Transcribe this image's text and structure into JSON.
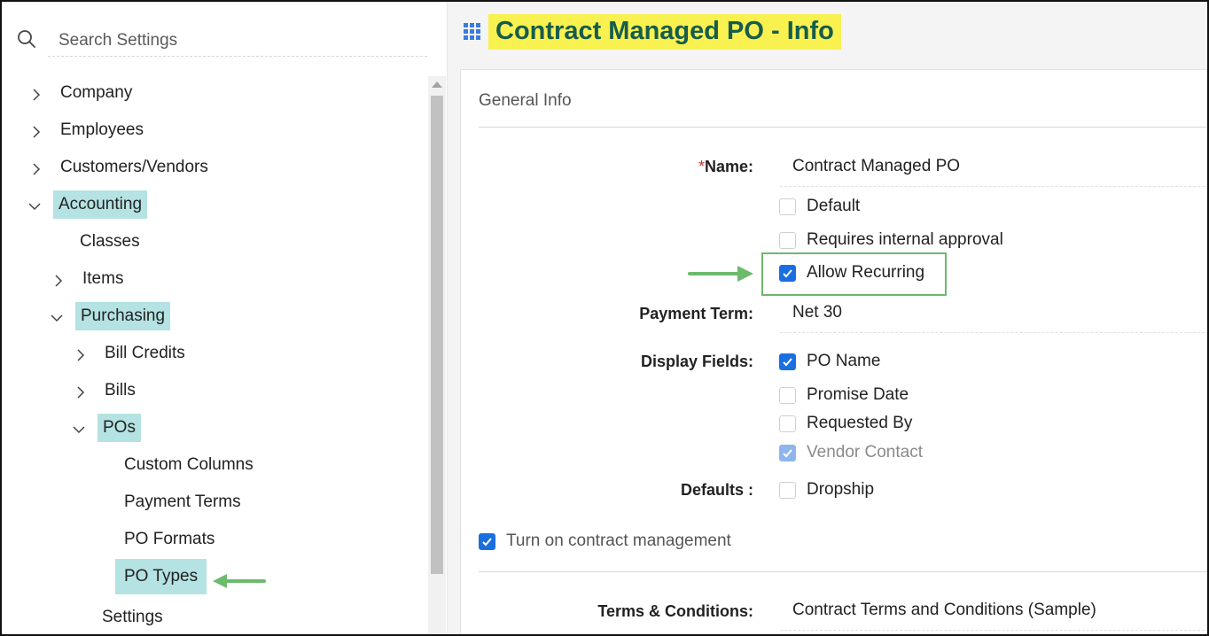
{
  "search": {
    "placeholder": "Search Settings"
  },
  "sidebar": {
    "items": [
      {
        "label": "Company",
        "expanded": false,
        "selected": false
      },
      {
        "label": "Employees",
        "expanded": false,
        "selected": false
      },
      {
        "label": "Customers/Vendors",
        "expanded": false,
        "selected": false
      },
      {
        "label": "Accounting",
        "expanded": true,
        "selected": true
      },
      {
        "label": "Classes",
        "expanded": null,
        "selected": false
      },
      {
        "label": "Items",
        "expanded": false,
        "selected": false
      },
      {
        "label": "Purchasing",
        "expanded": true,
        "selected": true
      },
      {
        "label": "Bill Credits",
        "expanded": false,
        "selected": false
      },
      {
        "label": "Bills",
        "expanded": false,
        "selected": false
      },
      {
        "label": "POs",
        "expanded": true,
        "selected": true
      },
      {
        "label": "Custom Columns",
        "expanded": null,
        "selected": false
      },
      {
        "label": "Payment Terms",
        "expanded": null,
        "selected": false
      },
      {
        "label": "PO Formats",
        "expanded": null,
        "selected": false
      },
      {
        "label": "PO Types",
        "expanded": null,
        "selected": true
      },
      {
        "label": "Settings",
        "expanded": null,
        "selected": false
      }
    ]
  },
  "page": {
    "title": "Contract Managed PO - Info"
  },
  "general_info": {
    "section_title": "General Info",
    "name_label": "Name:",
    "name_required": "*",
    "name_value": "Contract Managed PO",
    "default_label": "Default",
    "default_checked": false,
    "requires_approval_label": "Requires internal approval",
    "requires_approval_checked": false,
    "allow_recurring_label": "Allow Recurring",
    "allow_recurring_checked": true,
    "payment_term_label": "Payment Term:",
    "payment_term_value": "Net 30",
    "display_fields_label": "Display Fields:",
    "display_fields": [
      {
        "label": "PO Name",
        "checked": true,
        "disabled": false
      },
      {
        "label": "Promise Date",
        "checked": false,
        "disabled": false
      },
      {
        "label": "Requested By",
        "checked": false,
        "disabled": false
      },
      {
        "label": "Vendor Contact",
        "checked": true,
        "disabled": true
      }
    ],
    "defaults_label": "Defaults :",
    "dropship_label": "Dropship",
    "dropship_checked": false,
    "contract_mgmt_label": "Turn on contract management",
    "contract_mgmt_checked": true,
    "terms_label": "Terms & Conditions:",
    "terms_value": "Contract Terms and Conditions (Sample)"
  },
  "colors": {
    "title_highlight": "#f8f150",
    "title_text": "#165c4c",
    "selected_item_bg": "#b5e2e2",
    "checkbox_blue": "#1a6fe0",
    "annotation_green": "#6cba6c"
  }
}
